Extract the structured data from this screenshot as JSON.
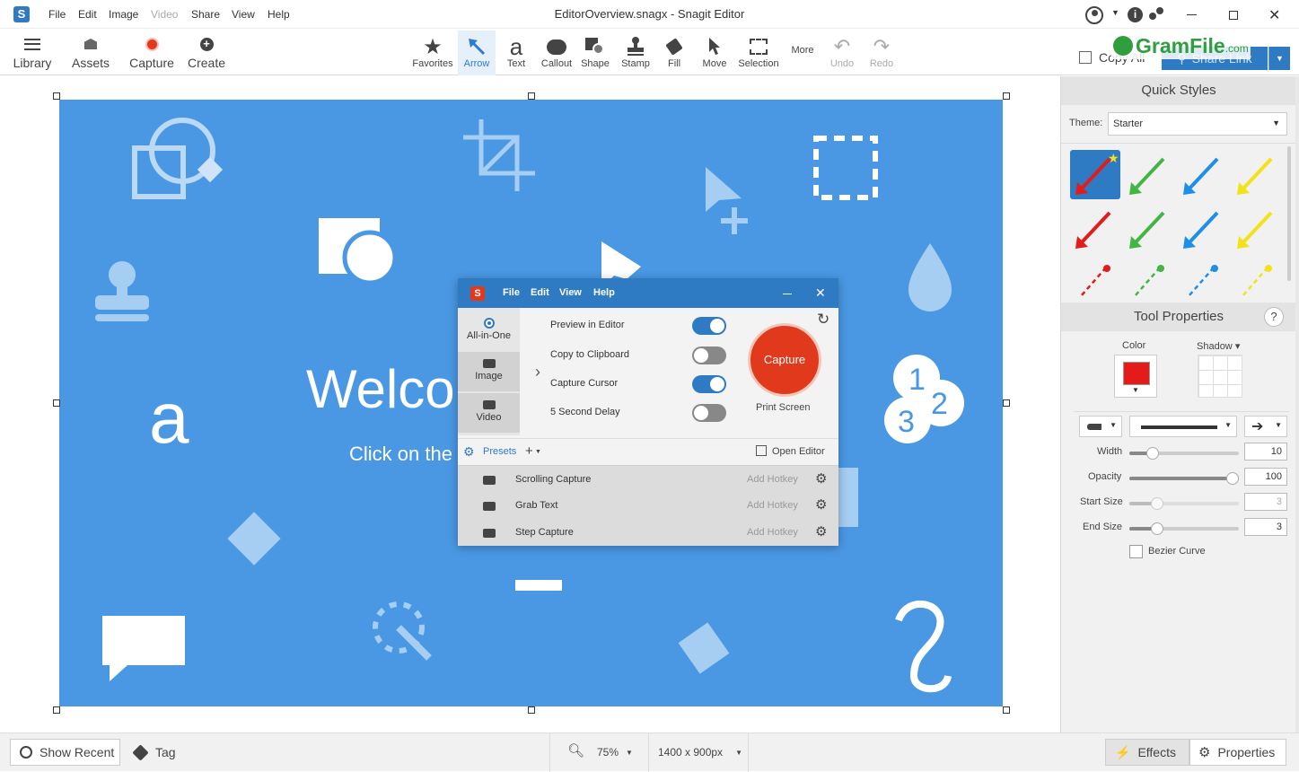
{
  "window": {
    "title": "EditorOverview.snagx - Snagit Editor",
    "menu": [
      "File",
      "Edit",
      "Image",
      "Video",
      "Share",
      "View",
      "Help"
    ],
    "menu_disabled": [
      "Video"
    ]
  },
  "toolbar": {
    "left": [
      {
        "label": "Library",
        "icon": "hamburger-icon"
      },
      {
        "label": "Assets",
        "icon": "assets-icon"
      },
      {
        "label": "Capture",
        "icon": "record-icon"
      },
      {
        "label": "Create",
        "icon": "plus-circle-icon"
      }
    ],
    "tools": [
      {
        "label": "Favorites",
        "icon": "star-icon"
      },
      {
        "label": "Arrow",
        "icon": "arrow-tool-icon",
        "active": true
      },
      {
        "label": "Text",
        "icon": "text-a-icon"
      },
      {
        "label": "Callout",
        "icon": "speech-bubble-icon"
      },
      {
        "label": "Shape",
        "icon": "shape-icon"
      },
      {
        "label": "Stamp",
        "icon": "stamp-icon"
      },
      {
        "label": "Fill",
        "icon": "fill-bucket-icon"
      },
      {
        "label": "Move",
        "icon": "move-cursor-icon"
      },
      {
        "label": "Selection",
        "icon": "selection-rect-icon"
      }
    ],
    "more": "More",
    "undo": "Undo",
    "redo": "Redo",
    "copy_all": "Copy All",
    "share_link": "Share Link",
    "watermark": "GramFile",
    "watermark_suffix": ".com"
  },
  "canvas": {
    "welcome": "Welco",
    "subtitle": "Click on the"
  },
  "capture_dialog": {
    "menu": [
      "File",
      "Edit",
      "View",
      "Help"
    ],
    "modes": [
      "All-in-One",
      "Image",
      "Video"
    ],
    "options": [
      {
        "label": "Preview in Editor",
        "on": true
      },
      {
        "label": "Copy to Clipboard",
        "on": false
      },
      {
        "label": "Capture Cursor",
        "on": true
      },
      {
        "label": "5 Second Delay",
        "on": false
      }
    ],
    "capture_button": "Capture",
    "print_screen": "Print Screen",
    "presets_label": "Presets",
    "presets_add": "+",
    "open_editor": "Open Editor",
    "presets": [
      {
        "name": "Scrolling Capture",
        "hotkey": "Add Hotkey"
      },
      {
        "name": "Grab Text",
        "hotkey": "Add Hotkey"
      },
      {
        "name": "Step Capture",
        "hotkey": "Add Hotkey"
      }
    ]
  },
  "quick_styles": {
    "title": "Quick Styles",
    "theme_label": "Theme:",
    "theme_value": "Starter"
  },
  "tool_properties": {
    "title": "Tool Properties",
    "help": "?",
    "color_label": "Color",
    "shadow_label": "Shadow",
    "color": "#e02020",
    "width_label": "Width",
    "width_value": "10",
    "opacity_label": "Opacity",
    "opacity_value": "100",
    "start_size_label": "Start Size",
    "start_size_value": "3",
    "end_size_label": "End Size",
    "end_size_value": "3",
    "bezier_label": "Bezier Curve",
    "bezier_checked": false
  },
  "statusbar": {
    "show_recent": "Show Recent",
    "tag": "Tag",
    "zoom": "75%",
    "dimensions": "1400 x 900px",
    "effects": "Effects",
    "properties": "Properties"
  },
  "colors": {
    "canvas_bg": "#4a98e3",
    "accent": "#2f7bc3",
    "capture_red": "#e0391c"
  }
}
